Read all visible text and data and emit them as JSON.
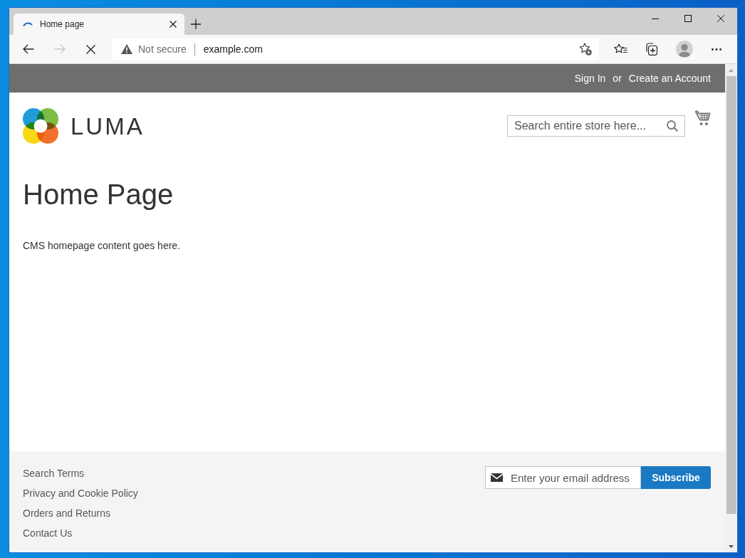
{
  "browser": {
    "tabs": [
      {
        "title": "Home page",
        "selected": true,
        "loading": true
      }
    ],
    "navigation": {
      "back_disabled": false,
      "forward_disabled": true
    },
    "address_bar": {
      "security": "Not secure",
      "url": "example.com"
    }
  },
  "page": {
    "header": {
      "sign_in": "Sign In",
      "separator": "or",
      "create_account": "Create an Account"
    },
    "logo": {
      "text": "LUMA"
    },
    "search": {
      "placeholder": "Search entire store here..."
    },
    "title": "Home Page",
    "content": "CMS homepage content goes here.",
    "footer": {
      "links": [
        "Search Terms",
        "Privacy and Cookie Policy",
        "Orders and Returns",
        "Contact Us"
      ],
      "newsletter": {
        "placeholder": "Enter your email address",
        "button": "Subscribe"
      }
    }
  }
}
